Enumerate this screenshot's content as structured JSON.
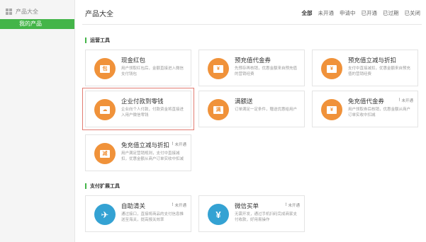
{
  "sidebar": {
    "header": "产品大全",
    "item_active": "我的产品"
  },
  "main": {
    "title": "产品大全",
    "filters": [
      "全部",
      "未开通",
      "申请中",
      "已开通",
      "已过期",
      "已关闭"
    ]
  },
  "sections": {
    "marketing": "运营工具",
    "payment": "支付扩展工具"
  },
  "cards": {
    "cash_red_packet": {
      "title": "现金红包",
      "desc": "用户领取红包后，金额直接进入微信支付钱包",
      "glyph": "包"
    },
    "prepaid_voucher": {
      "title": "预充值代金券",
      "desc": "先预存再核销，优惠金额来自预充值的营销经费",
      "glyph": "¥"
    },
    "prepaid_discount": {
      "title": "预充值立减与折扣",
      "desc": "支付中直接减扣，优惠金额来自预充值的营销经费",
      "glyph": "¥"
    },
    "enterprise_payment": {
      "title": "企业付款到零钱",
      "desc": "企业向个人付款，付款资金将直接进入用户微信零钱",
      "glyph": "☁"
    },
    "full_reduction": {
      "title": "满额送",
      "desc": "订单满足一定条件，赠送优惠给用户",
      "glyph": "满"
    },
    "free_voucher": {
      "title": "免充值代金券",
      "desc": "用户领取券后核销，优惠金额从商户订单实收中扣减",
      "glyph": "¥",
      "status": "未开通"
    },
    "free_discount": {
      "title": "免充值立减与折扣",
      "desc": "用户满足营销规则，支付中直接减扣，优惠金额从商户订单实收中扣减",
      "glyph": "减",
      "status": "未开通"
    },
    "customs": {
      "title": "自助清关",
      "desc": "通过接口，直接将商品的支付信息推送至海关，提高报关效率",
      "glyph": "✈",
      "status": "未开通"
    },
    "wechat_buy": {
      "title": "微信买单",
      "desc": "无需开发，通过手机扫码完成商家支付收款，好用易操作",
      "glyph": "¥",
      "status": "未开通"
    }
  },
  "colors": {
    "accent": "#44b549",
    "orange": "#f0923a",
    "blue": "#34a2d3",
    "highlight": "#e27c73"
  }
}
